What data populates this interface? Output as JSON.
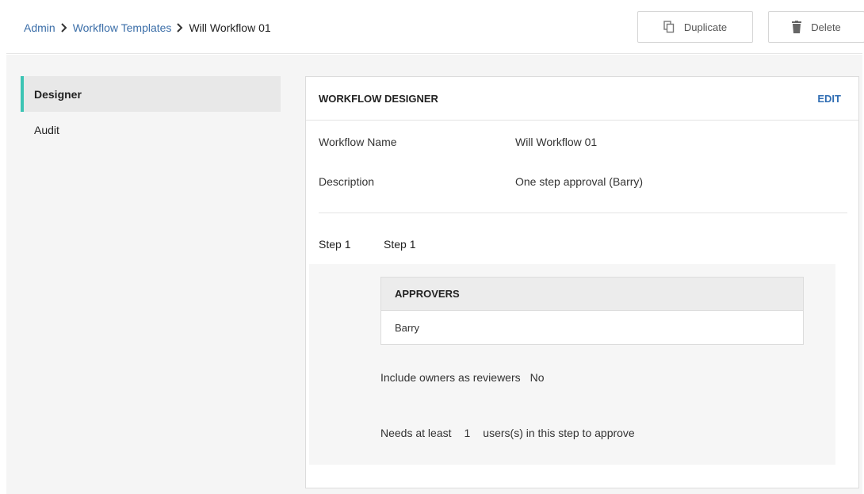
{
  "breadcrumb": {
    "items": [
      "Admin",
      "Workflow Templates"
    ],
    "current": "Will Workflow 01"
  },
  "toolbar": {
    "duplicate_label": "Duplicate",
    "delete_label": "Delete",
    "duplicate_icon": "copy-icon",
    "delete_icon": "trash-icon"
  },
  "sidebar": {
    "items": [
      {
        "label": "Designer",
        "active": true
      },
      {
        "label": "Audit",
        "active": false
      }
    ]
  },
  "panel": {
    "title": "WORKFLOW DESIGNER",
    "edit_label": "EDIT",
    "fields": [
      {
        "label": "Workflow Name",
        "value": "Will Workflow 01"
      },
      {
        "label": "Description",
        "value": "One step approval (Barry)"
      }
    ],
    "step": {
      "number": "Step 1",
      "name": "Step 1",
      "approvers_header": "APPROVERS",
      "approvers": [
        "Barry"
      ],
      "include_owners_label": "Include owners as reviewers",
      "include_owners_value": "No",
      "needs_prefix": "Needs at least",
      "needs_count": "1",
      "needs_suffix": "users(s) in this step to approve"
    }
  },
  "colors": {
    "link": "#3b6ea8",
    "accent": "#3cc4b4",
    "edit": "#2f6db3"
  }
}
